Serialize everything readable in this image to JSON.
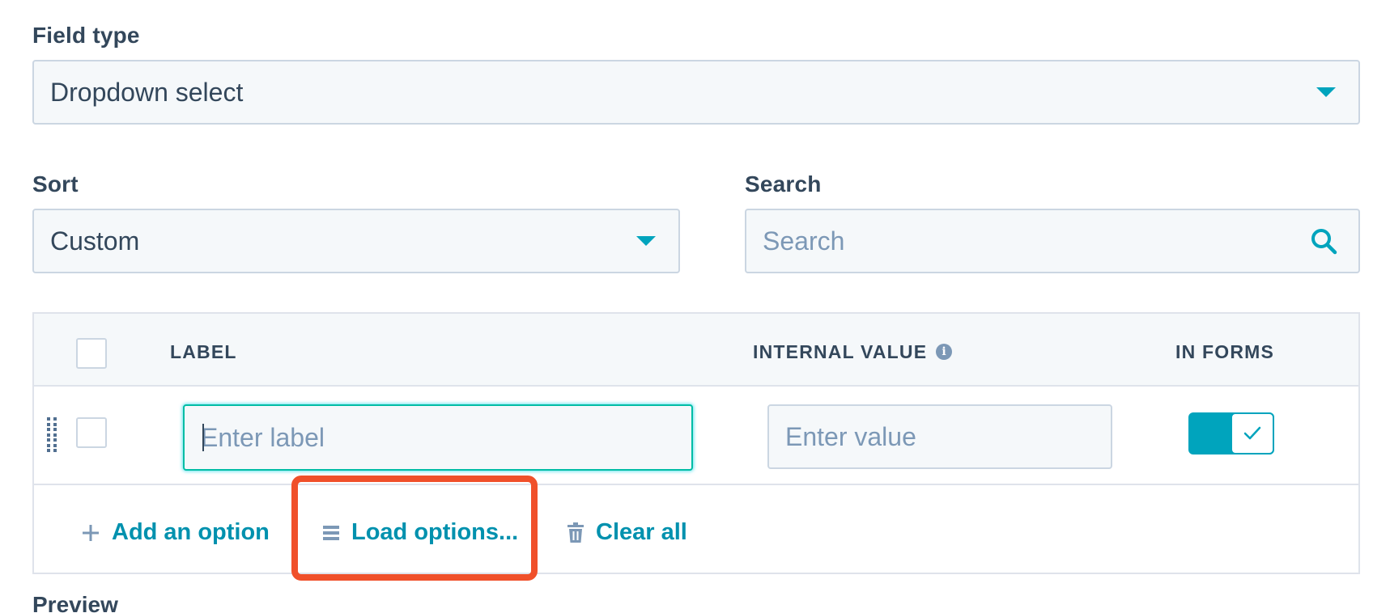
{
  "field_type": {
    "label": "Field type",
    "value": "Dropdown select"
  },
  "sort": {
    "label": "Sort",
    "value": "Custom"
  },
  "search": {
    "label": "Search",
    "placeholder": "Search"
  },
  "options_table": {
    "columns": {
      "label": "LABEL",
      "internal_value": "INTERNAL VALUE",
      "in_forms": "IN FORMS"
    },
    "rows": [
      {
        "label_placeholder": "Enter label",
        "value_placeholder": "Enter value",
        "in_forms_enabled": true
      }
    ],
    "actions": {
      "add_option": "Add an option",
      "load_options": "Load options...",
      "clear_all": "Clear all"
    }
  },
  "preview": {
    "label": "Preview"
  },
  "colors": {
    "accent": "#00a4bd",
    "link": "#0091ae",
    "highlight": "#f0502a",
    "text": "#33475b",
    "muted": "#7c98b6"
  },
  "icons": {
    "field_type_caret": "chevron-down-icon",
    "sort_caret": "chevron-down-icon",
    "search": "search-icon",
    "info": "info-icon",
    "drag": "drag-handle-icon",
    "toggle_check": "check-icon",
    "add": "plus-icon",
    "load": "list-icon",
    "clear": "trash-icon"
  }
}
